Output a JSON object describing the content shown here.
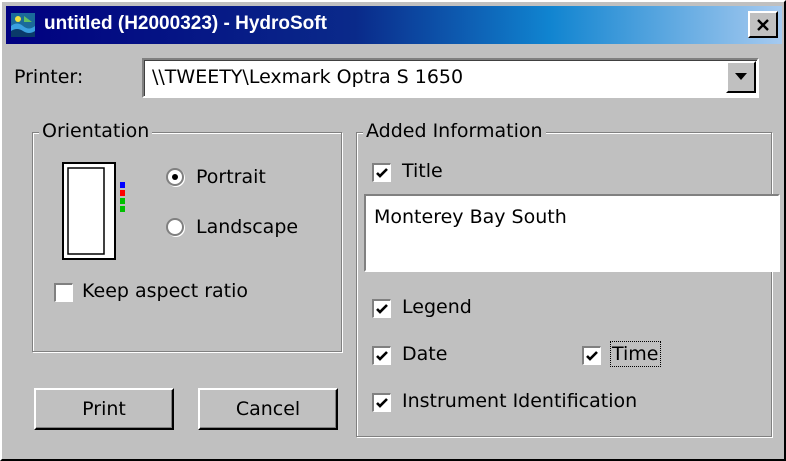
{
  "window": {
    "title": "untitled (H2000323) - HydroSoft"
  },
  "printer": {
    "label": "Printer:",
    "value": "\\\\TWEETY\\Lexmark Optra S 1650"
  },
  "orientation": {
    "group_title": "Orientation",
    "portrait_label": "Portrait",
    "landscape_label": "Landscape",
    "selected": "Portrait",
    "keep_aspect_label": "Keep aspect ratio",
    "keep_aspect_checked": false
  },
  "added_info": {
    "group_title": "Added Information",
    "title_label": "Title",
    "title_checked": true,
    "title_value": "Monterey Bay South",
    "legend_label": "Legend",
    "legend_checked": true,
    "date_label": "Date",
    "date_checked": true,
    "time_label": "Time",
    "time_checked": true,
    "instrument_label": "Instrument Identification",
    "instrument_checked": true
  },
  "buttons": {
    "print": "Print",
    "cancel": "Cancel"
  },
  "icons": {
    "app": "hydrosoft-app-icon",
    "close": "close-icon",
    "dropdown": "dropdown-arrow-icon",
    "page": "portrait-page-icon"
  }
}
